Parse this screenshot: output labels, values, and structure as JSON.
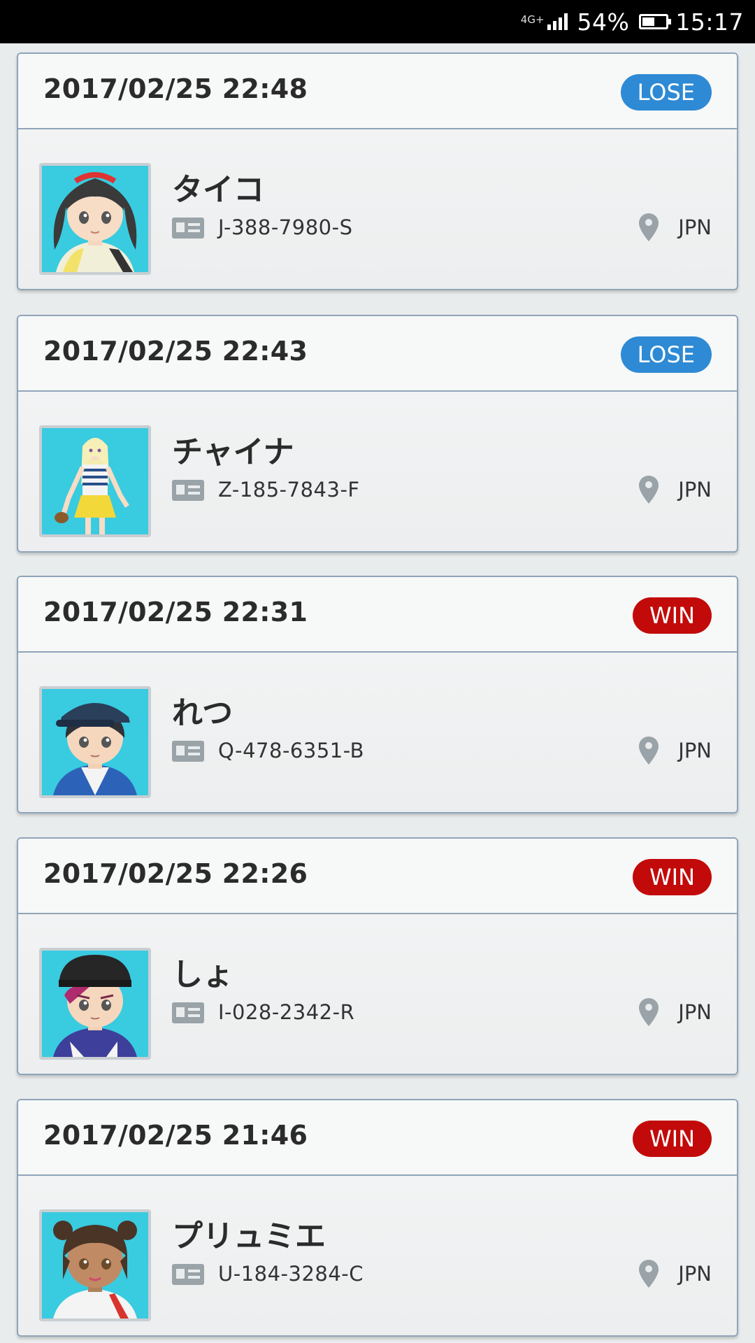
{
  "status_bar": {
    "network": "4G+",
    "battery_percent": "54%",
    "battery_level": 0.54,
    "time": "15:17"
  },
  "battles": [
    {
      "date": "2017/02/25 22:48",
      "result": "LOSE",
      "name": "タイコ",
      "friend_code": "J-388-7980-S",
      "region": "JPN"
    },
    {
      "date": "2017/02/25 22:43",
      "result": "LOSE",
      "name": "チャイナ",
      "friend_code": "Z-185-7843-F",
      "region": "JPN"
    },
    {
      "date": "2017/02/25 22:31",
      "result": "WIN",
      "name": "れつ",
      "friend_code": "Q-478-6351-B",
      "region": "JPN"
    },
    {
      "date": "2017/02/25 22:26",
      "result": "WIN",
      "name": "しょ",
      "friend_code": "I-028-2342-R",
      "region": "JPN"
    },
    {
      "date": "2017/02/25 21:46",
      "result": "WIN",
      "name": "プリュミエ",
      "friend_code": "U-184-3284-C",
      "region": "JPN"
    }
  ],
  "colors": {
    "lose": "#2e8ad4",
    "win": "#c20a0a",
    "avatar_bg": "#39cbe0",
    "card_border": "#8fa4b8"
  }
}
